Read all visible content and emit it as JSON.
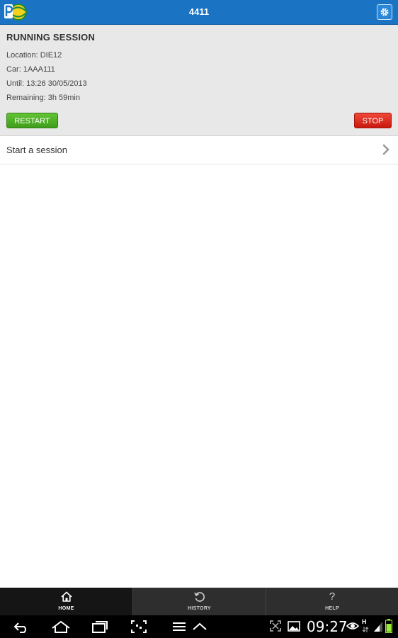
{
  "appbar": {
    "title": "4411"
  },
  "session": {
    "heading": "RUNNING SESSION",
    "location": "Location: DIE12",
    "car": "Car: 1AAA111",
    "until": "Until: 13:26 30/05/2013",
    "remaining": "Remaining: 3h 59min",
    "restart_label": "RESTART",
    "stop_label": "STOP"
  },
  "list": {
    "start_session": "Start a session"
  },
  "tabs": [
    {
      "label": "HOME",
      "icon": "home-icon",
      "active": true
    },
    {
      "label": "HISTORY",
      "icon": "history-icon",
      "active": false
    },
    {
      "label": "HELP",
      "icon": "help-icon",
      "glyph": "?",
      "active": false
    }
  ],
  "system": {
    "clock": "09:27",
    "signal_letter": "H"
  },
  "colors": {
    "appbar": "#1a74c3",
    "restart": "#4caf27",
    "stop": "#e0281b",
    "panel": "#e8e8e8"
  }
}
